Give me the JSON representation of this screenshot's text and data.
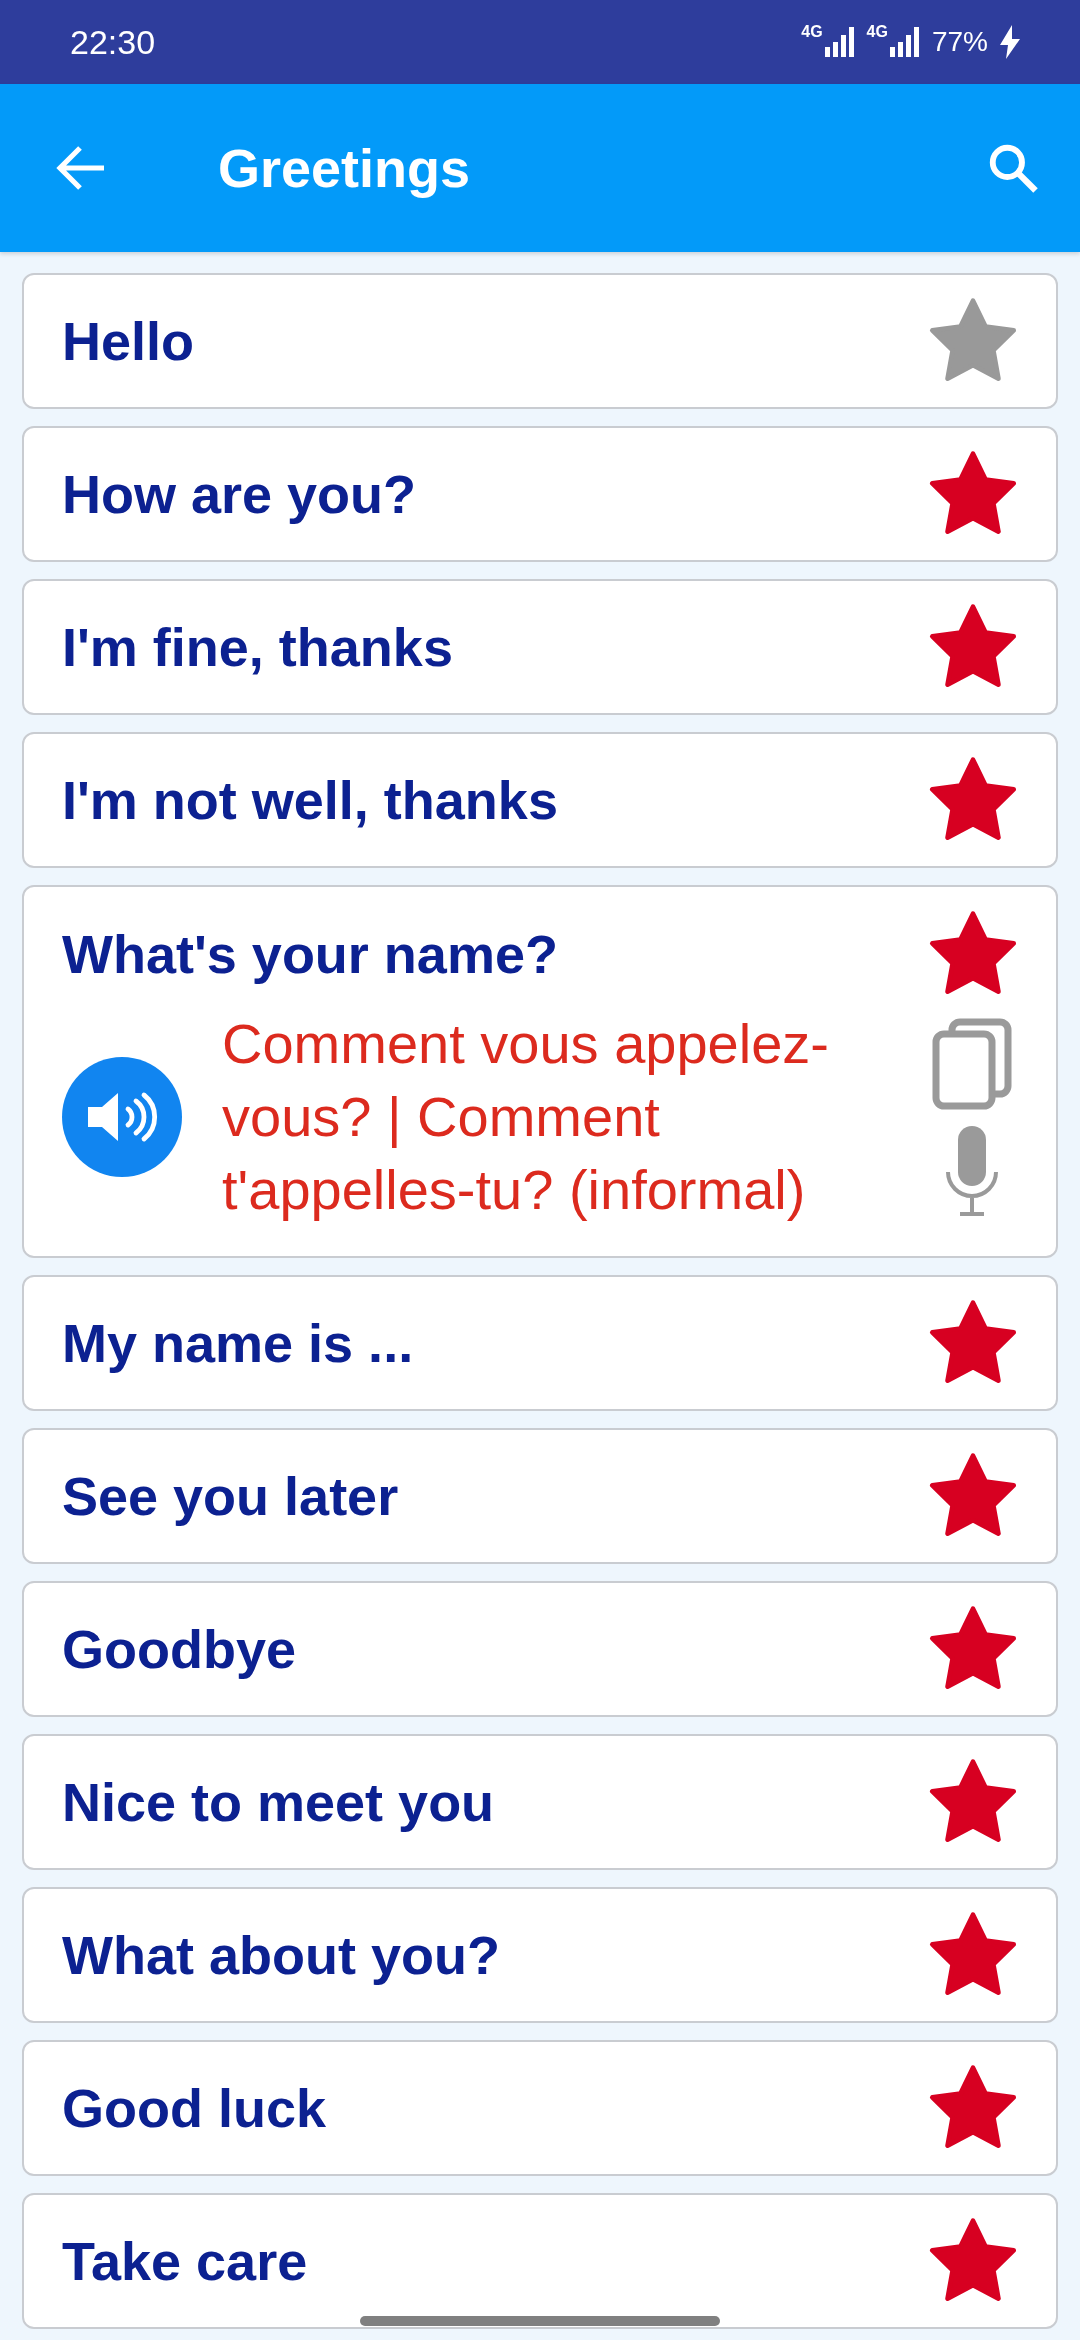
{
  "status_bar": {
    "time": "22:30",
    "networks": [
      {
        "label": "4G"
      },
      {
        "label": "4G"
      }
    ],
    "battery": "77%",
    "charging": true
  },
  "app_bar": {
    "title": "Greetings"
  },
  "phrases": [
    {
      "text": "Hello",
      "favorite": false,
      "expanded": false
    },
    {
      "text": "How are you?",
      "favorite": true,
      "expanded": false
    },
    {
      "text": "I'm fine, thanks",
      "favorite": true,
      "expanded": false
    },
    {
      "text": "I'm not well, thanks",
      "favorite": true,
      "expanded": false
    },
    {
      "text": "What's your name?",
      "favorite": true,
      "expanded": true,
      "translation": "Comment vous appelez-vous? | Comment t'appelles-tu? (informal)"
    },
    {
      "text": "My name is ...",
      "favorite": true,
      "expanded": false
    },
    {
      "text": "See you later",
      "favorite": true,
      "expanded": false
    },
    {
      "text": "Goodbye",
      "favorite": true,
      "expanded": false
    },
    {
      "text": "Nice to meet you",
      "favorite": true,
      "expanded": false
    },
    {
      "text": "What about you?",
      "favorite": true,
      "expanded": false
    },
    {
      "text": "Good luck",
      "favorite": true,
      "expanded": false
    },
    {
      "text": "Take care",
      "favorite": true,
      "expanded": false
    }
  ]
}
